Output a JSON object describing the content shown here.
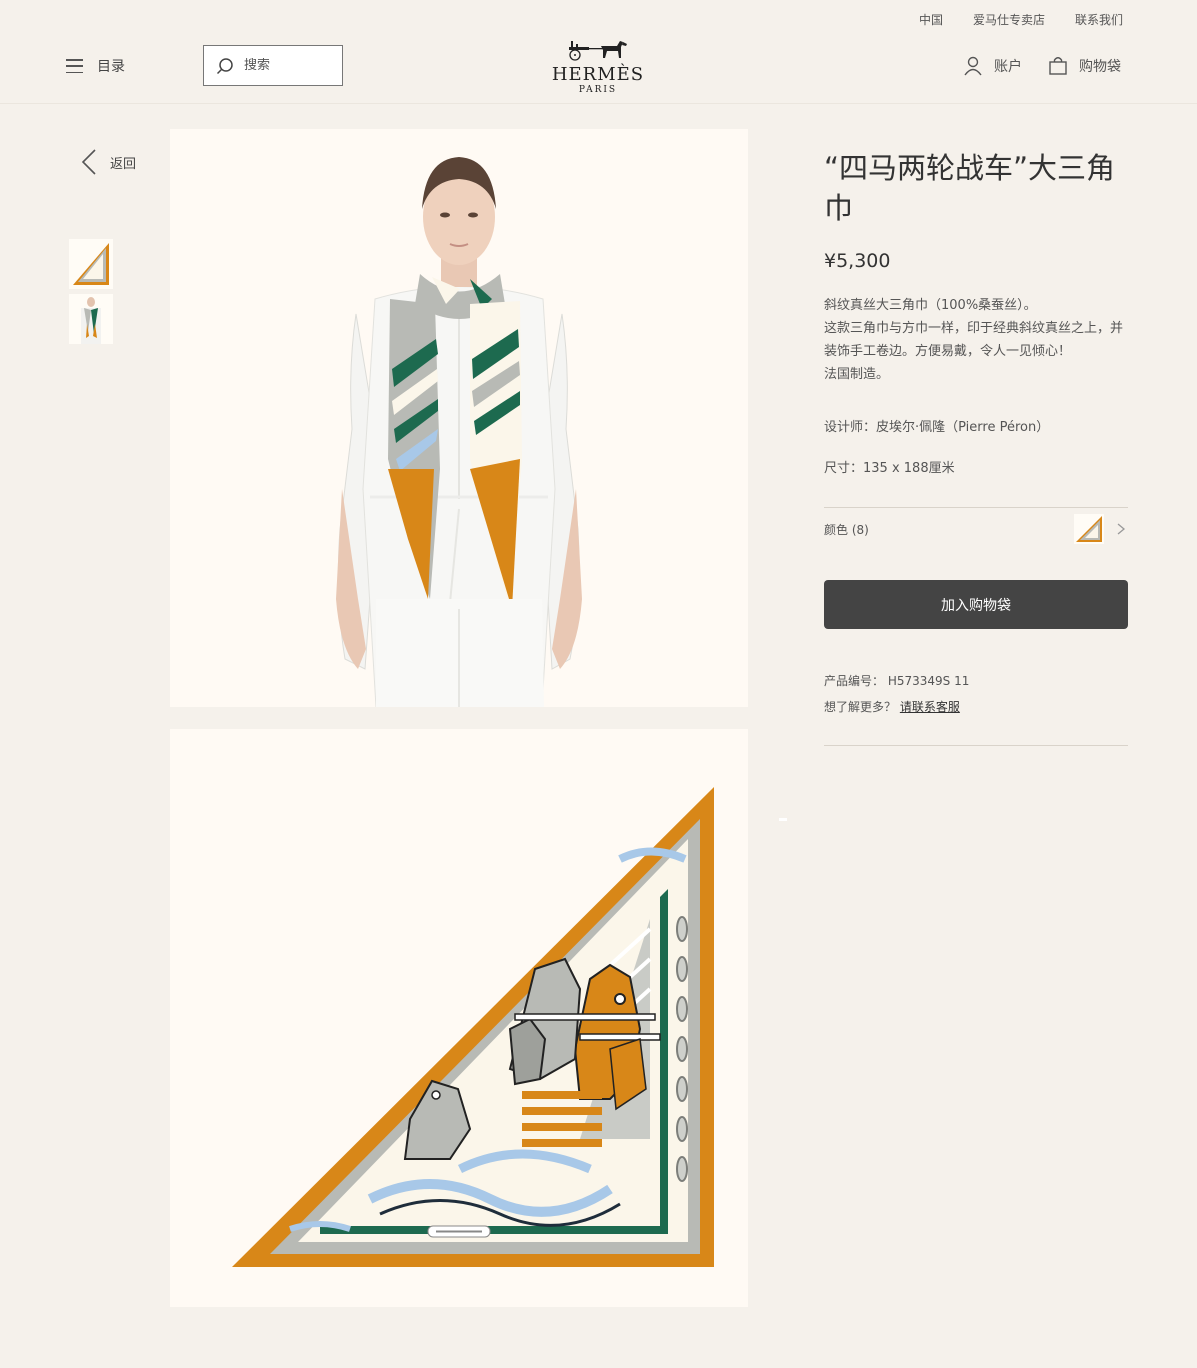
{
  "header": {
    "top_links": [
      "中国",
      "爱马仕专卖店",
      "联系我们"
    ],
    "menu_label": "目录",
    "search_placeholder": "搜索",
    "logo_brand": "HERMÈS",
    "logo_city": "PARIS",
    "account_label": "账户",
    "bag_label": "购物袋"
  },
  "sidebar": {
    "back_label": "返回"
  },
  "product": {
    "title": "“四马两轮战车”大三角巾",
    "price": "¥5,300",
    "description": [
      "斜纹真丝大三角巾（100%桑蚕丝）。",
      "这款三角巾与方巾一样，印于经典斜纹真丝之上，并装饰手工卷边。方便易戴，令人一见倾心！",
      "法国制造。"
    ],
    "designer": "设计师：皮埃尔·佩隆（Pierre Péron）",
    "size": "尺寸：135 x 188厘米",
    "color_label": "颜色 (8)",
    "add_to_bag": "加入购物袋",
    "ref_label": "产品编号：",
    "ref_value": "H573349S 11",
    "more_label": "想了解更多？",
    "contact_link": "请联系客服"
  },
  "colors": {
    "orange": "#d88718",
    "green": "#1d6a4f",
    "grey": "#b8bab5",
    "light_blue": "#a8c8e8",
    "cream": "#fbf6ea",
    "button": "#444444"
  },
  "images": {
    "model_photo": "model-wearing-scarf",
    "scarf_photo": "triangle-scarf-flat"
  }
}
